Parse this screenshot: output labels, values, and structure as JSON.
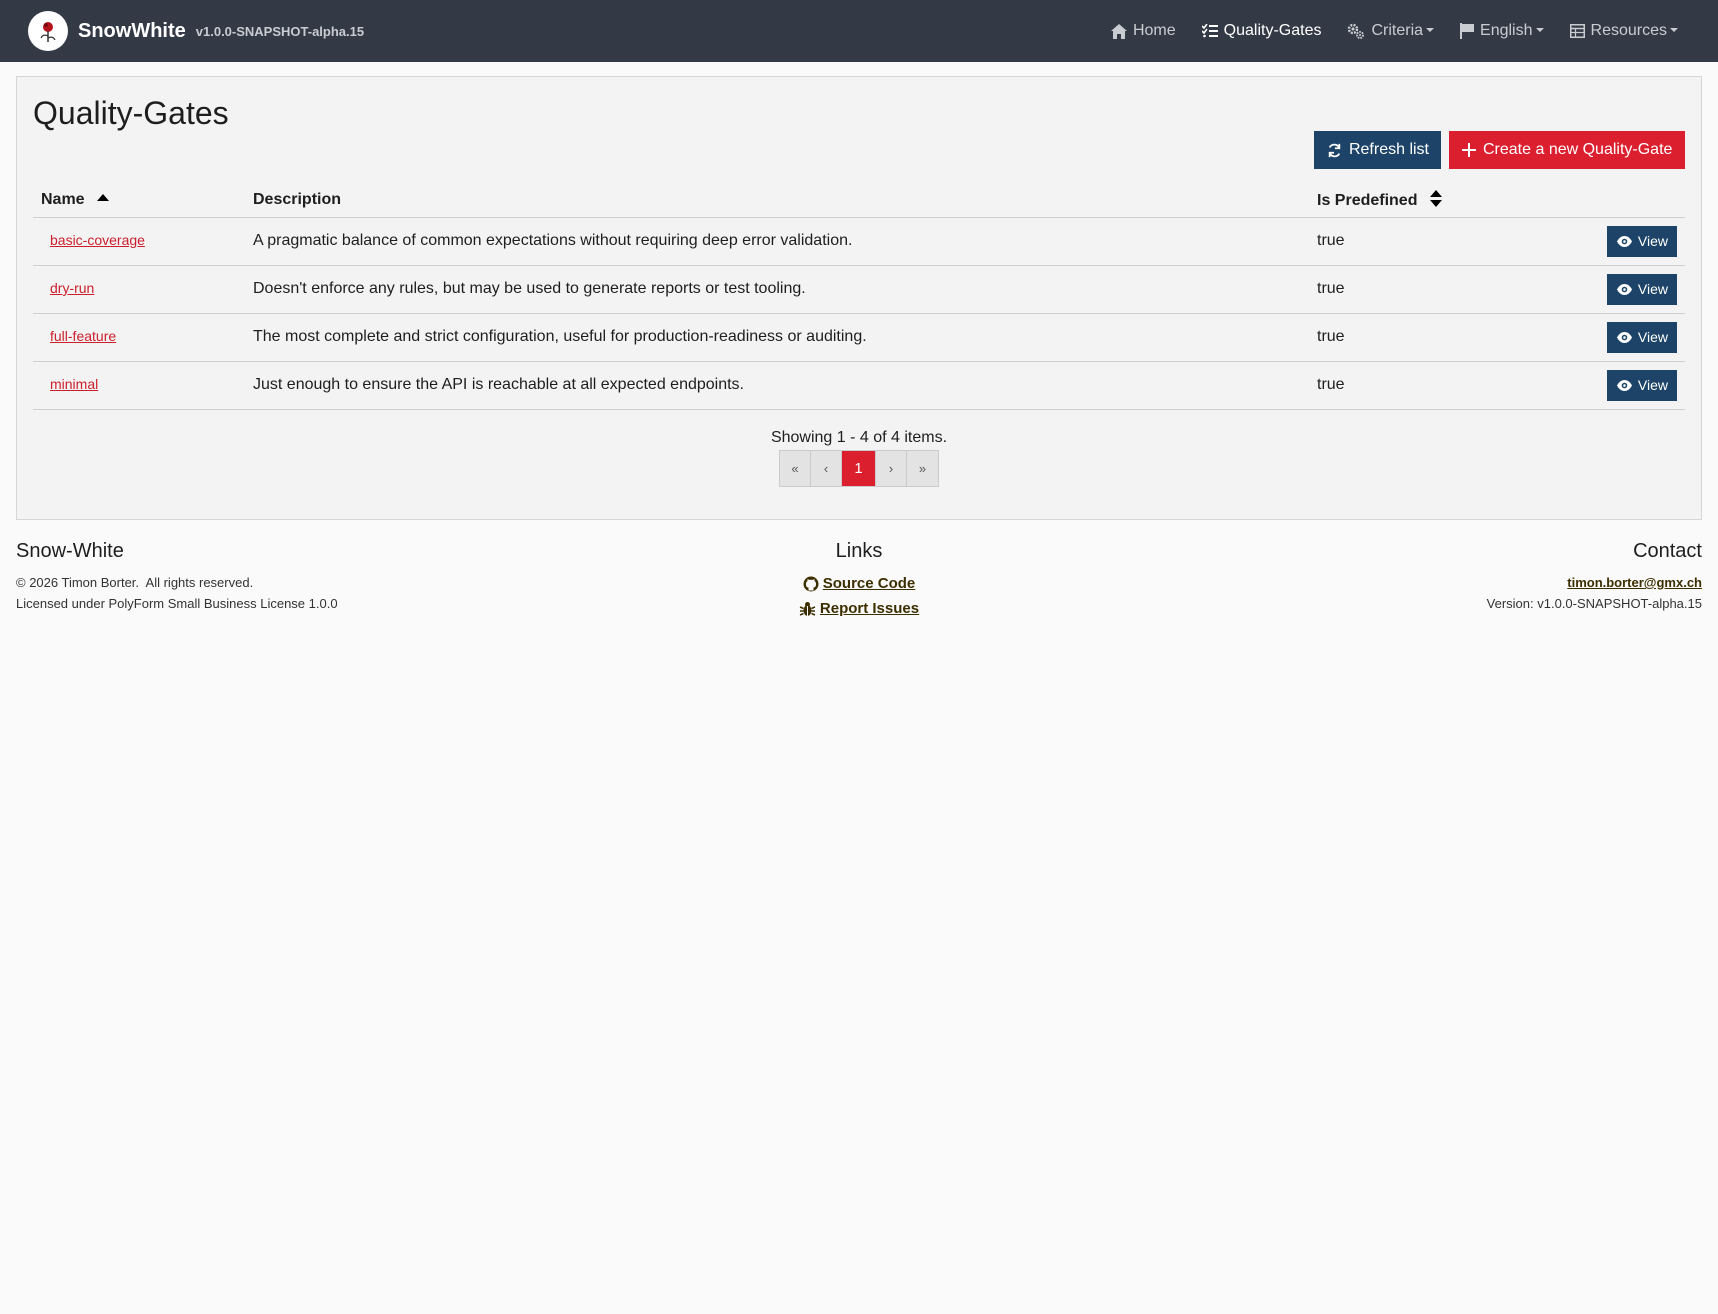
{
  "navbar": {
    "brand_name": "SnowWhite",
    "brand_version": "v1.0.0-SNAPSHOT-alpha.15",
    "items": [
      {
        "label": "Home",
        "icon": "home-icon"
      },
      {
        "label": "Quality-Gates",
        "icon": "list-check-icon"
      },
      {
        "label": "Criteria",
        "icon": "gears-icon"
      },
      {
        "label": "English",
        "icon": "flag-icon"
      },
      {
        "label": "Resources",
        "icon": "table-icon"
      }
    ]
  },
  "page": {
    "title": "Quality-Gates",
    "refresh_label": "Refresh list",
    "create_label": "Create a new Quality-Gate"
  },
  "table": {
    "headers": {
      "name": "Name",
      "description": "Description",
      "is_predefined": "Is Predefined"
    },
    "view_label": "View",
    "rows": [
      {
        "name": "basic-coverage",
        "description": "A pragmatic balance of common expectations without requiring deep error validation.",
        "is_predefined": "true"
      },
      {
        "name": "dry-run",
        "description": "Doesn't enforce any rules, but may be used to generate reports or test tooling.",
        "is_predefined": "true"
      },
      {
        "name": "full-feature",
        "description": "The most complete and strict configuration, useful for production-readiness or auditing.",
        "is_predefined": "true"
      },
      {
        "name": "minimal",
        "description": "Just enough to ensure the API is reachable at all expected endpoints.",
        "is_predefined": "true"
      }
    ]
  },
  "pagination": {
    "summary": "Showing 1 - 4 of 4 items.",
    "first": "«",
    "prev": "‹",
    "current": "1",
    "next": "›",
    "last": "»"
  },
  "footer": {
    "left_heading": "Snow-White",
    "copyright": "© 2026 Timon Borter.  All rights reserved.",
    "license": "Licensed under PolyForm Small Business License 1.0.0",
    "links_heading": "Links",
    "source_code": "Source Code",
    "report_issues": "Report Issues",
    "contact_heading": "Contact",
    "email": "timon.borter@gmx.ch",
    "version": "Version: v1.0.0-SNAPSHOT-alpha.15"
  },
  "colors": {
    "navbar_bg": "#343a45",
    "primary_blue": "#1d4468",
    "accent_red": "#dc1f2e",
    "link_red": "#cc1f2c",
    "footer_link": "#3d2e00"
  }
}
